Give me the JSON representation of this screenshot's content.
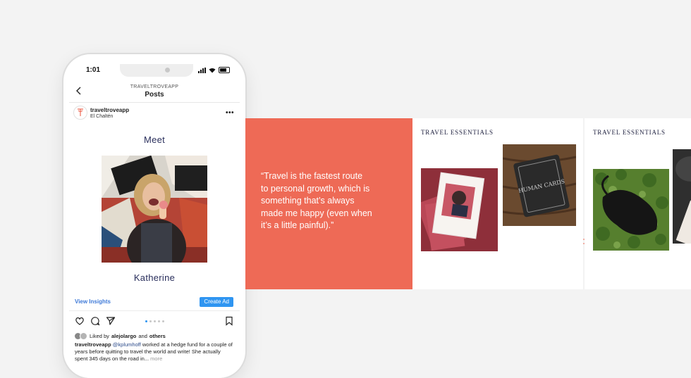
{
  "phone": {
    "status_time": "1:01",
    "header": {
      "account_upper": "TRAVELTROVEAPP",
      "title": "Posts"
    },
    "post": {
      "account": "traveltroveapp",
      "location": "El Chaltén",
      "meet_label": "Meet",
      "person_name": "Katherine"
    },
    "insights": {
      "view_label": "View Insights",
      "create_ad_label": "Create Ad"
    },
    "likes": {
      "prefix": "Liked by",
      "user": "alejolargo",
      "conj": "and",
      "others": "others"
    },
    "caption": {
      "account": "traveltroveapp",
      "mention": "@kplumhoff",
      "text": " worked at a hedge fund for a couple of years before quitting to travel the world and write! She actually spent 345 days on the road in...",
      "more": " more"
    },
    "carousel": {
      "total": 5,
      "active": 0
    }
  },
  "panels": {
    "quote": "“Travel is the fastest route\n  to personal growth, which is\n  something that’s always\n  made me happy (even when\n  it’s a little painful).”",
    "panel_one_label": "TRAVEL ESSENTIALS",
    "panel_two_label": "TRAVEL ESSENTIALS",
    "deck_text": "HUMAN CARDS"
  },
  "colors": {
    "background": "#f3f3f3",
    "accent": "#ee6a56",
    "navy_text": "#2a2f5c",
    "link_blue": "#2f95f1"
  }
}
